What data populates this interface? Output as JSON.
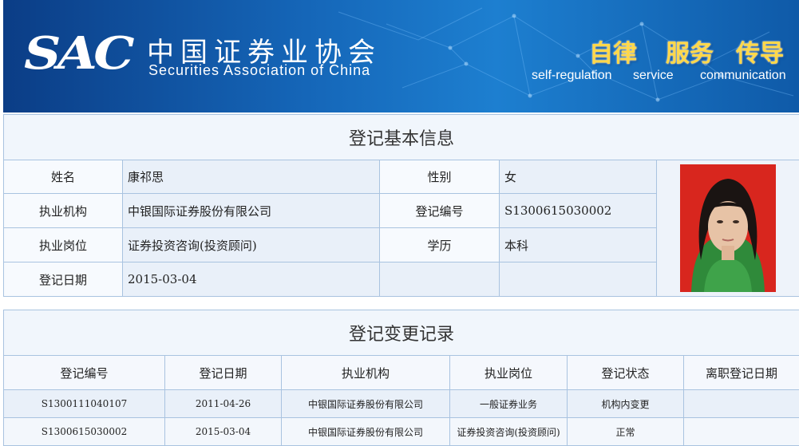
{
  "header": {
    "logo_text": "SAC",
    "org_name_cn": "中国证券业协会",
    "org_name_en": "Securities Association of China",
    "slogans": [
      {
        "cn": "自律",
        "en": "self-regulation"
      },
      {
        "cn": "服务",
        "en": "service"
      },
      {
        "cn": "传导",
        "en": "communication"
      }
    ]
  },
  "basic_info": {
    "title": "登记基本信息",
    "name_label": "姓名",
    "name_value": "康祁思",
    "gender_label": "性别",
    "gender_value": "女",
    "institution_label": "执业机构",
    "institution_value": "中银国际证券股份有限公司",
    "reg_no_label": "登记编号",
    "reg_no_value": "S1300615030002",
    "position_label": "执业岗位",
    "position_value": "证券投资咨询(投资顾问)",
    "education_label": "学历",
    "education_value": "本科",
    "reg_date_label": "登记日期",
    "reg_date_value": "2015-03-04"
  },
  "change_records": {
    "title": "登记变更记录",
    "columns": [
      "登记编号",
      "登记日期",
      "执业机构",
      "执业岗位",
      "登记状态",
      "离职登记日期"
    ],
    "rows": [
      [
        "S1300111040107",
        "2011-04-26",
        "中银国际证券股份有限公司",
        "一般证券业务",
        "机构内变更",
        ""
      ],
      [
        "S1300615030002",
        "2015-03-04",
        "中银国际证券股份有限公司",
        "证券投资咨询(投资顾问)",
        "正常",
        ""
      ]
    ]
  }
}
